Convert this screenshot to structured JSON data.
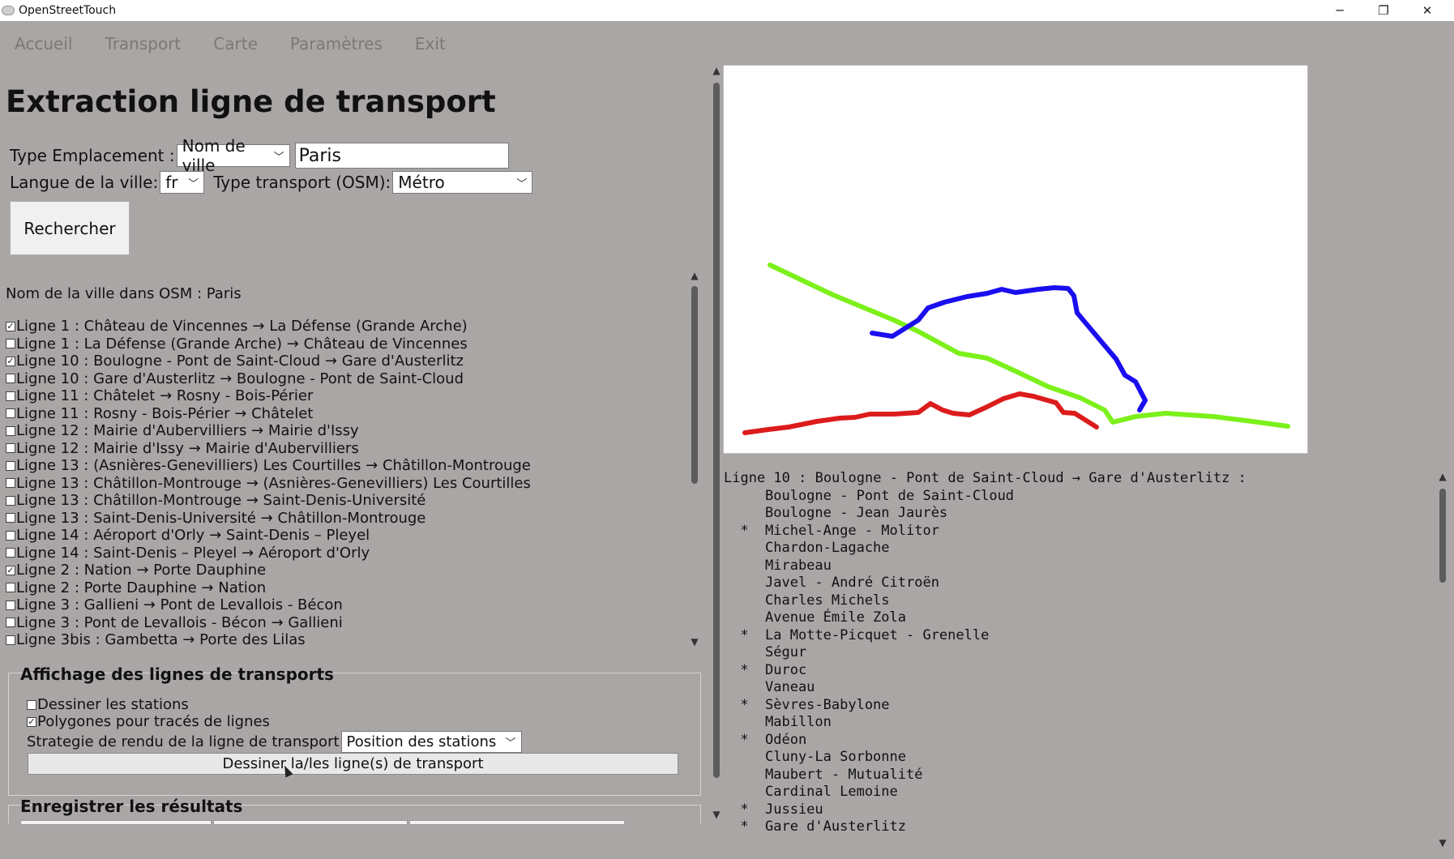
{
  "window": {
    "title": "OpenStreetTouch",
    "controls": [
      "─",
      "❐",
      "✕"
    ]
  },
  "menu": [
    "Accueil",
    "Transport",
    "Carte",
    "Paramètres",
    "Exit"
  ],
  "page": {
    "title": "Extraction ligne de transport"
  },
  "form": {
    "location_type_label": "Type Emplacement :",
    "location_type_value": "Nom de ville",
    "city_value": "Paris",
    "city_lang_label": "Langue de la ville:",
    "city_lang_value": "fr",
    "transport_type_label": "Type transport (OSM):",
    "transport_type_value": "Métro",
    "search_button": "Rechercher"
  },
  "osm_city": "Nom de la ville dans OSM : Paris",
  "lines": [
    {
      "label": "Ligne 1 : Château de Vincennes → La Défense (Grande Arche)",
      "checked": true
    },
    {
      "label": "Ligne 1 : La Défense (Grande Arche) → Château de Vincennes",
      "checked": false
    },
    {
      "label": "Ligne 10 : Boulogne - Pont de Saint-Cloud → Gare d'Austerlitz",
      "checked": true
    },
    {
      "label": "Ligne 10 : Gare d'Austerlitz → Boulogne - Pont de Saint-Cloud",
      "checked": false
    },
    {
      "label": "Ligne 11 : Châtelet → Rosny - Bois-Périer",
      "checked": false
    },
    {
      "label": "Ligne 11 : Rosny - Bois-Périer → Châtelet",
      "checked": false
    },
    {
      "label": "Ligne 12 : Mairie d'Aubervilliers → Mairie d'Issy",
      "checked": false
    },
    {
      "label": "Ligne 12 : Mairie d'Issy → Mairie d'Aubervilliers",
      "checked": false
    },
    {
      "label": "Ligne 13 : (Asnières-Genevilliers) Les Courtilles → Châtillon-Montrouge",
      "checked": false
    },
    {
      "label": "Ligne 13 : Châtillon-Montrouge → (Asnières-Genevilliers) Les Courtilles",
      "checked": false
    },
    {
      "label": "Ligne 13 : Châtillon-Montrouge → Saint-Denis-Université",
      "checked": false
    },
    {
      "label": "Ligne 13 : Saint-Denis-Université → Châtillon-Montrouge",
      "checked": false
    },
    {
      "label": "Ligne 14 : Aéroport d'Orly → Saint-Denis – Pleyel",
      "checked": false
    },
    {
      "label": "Ligne 14 : Saint-Denis – Pleyel → Aéroport d'Orly",
      "checked": false
    },
    {
      "label": "Ligne 2 : Nation → Porte Dauphine",
      "checked": true
    },
    {
      "label": "Ligne 2 : Porte Dauphine → Nation",
      "checked": false
    },
    {
      "label": "Ligne 3 : Gallieni → Pont de Levallois - Bécon",
      "checked": false
    },
    {
      "label": "Ligne 3 : Pont de Levallois - Bécon → Gallieni",
      "checked": false
    },
    {
      "label": "Ligne 3bis : Gambetta → Porte des Lilas",
      "checked": false
    }
  ],
  "display": {
    "title": "Affichage des lignes de transports",
    "draw_stations_label": "Dessiner les stations",
    "draw_stations_checked": false,
    "polygons_label": "Polygones pour tracés de lignes",
    "polygons_checked": true,
    "strategy_label": "Strategie de rendu de la ligne de transport",
    "strategy_value": "Position des stations",
    "draw_button": "Dessiner la/les ligne(s) de transport"
  },
  "save": {
    "title": "Enregistrer les résultats"
  },
  "map_colors": {
    "green": "#7cf01a",
    "blue": "#1a0ef0",
    "red": "#dc1c1c"
  },
  "stops": {
    "header": "Ligne 10 : Boulogne - Pont de Saint-Cloud → Gare d'Austerlitz :",
    "items": [
      {
        "mark": "",
        "name": "Boulogne - Pont de Saint-Cloud"
      },
      {
        "mark": "",
        "name": "Boulogne - Jean Jaurès"
      },
      {
        "mark": "*",
        "name": "Michel-Ange - Molitor"
      },
      {
        "mark": "",
        "name": "Chardon-Lagache"
      },
      {
        "mark": "",
        "name": "Mirabeau"
      },
      {
        "mark": "",
        "name": "Javel - André Citroën"
      },
      {
        "mark": "",
        "name": "Charles Michels"
      },
      {
        "mark": "",
        "name": "Avenue Émile Zola"
      },
      {
        "mark": "*",
        "name": "La Motte-Picquet - Grenelle"
      },
      {
        "mark": "",
        "name": "Ségur"
      },
      {
        "mark": "*",
        "name": "Duroc"
      },
      {
        "mark": "",
        "name": "Vaneau"
      },
      {
        "mark": "*",
        "name": "Sèvres-Babylone"
      },
      {
        "mark": "",
        "name": "Mabillon"
      },
      {
        "mark": "*",
        "name": "Odéon"
      },
      {
        "mark": "",
        "name": "Cluny-La Sorbonne"
      },
      {
        "mark": "",
        "name": "Maubert - Mutualité"
      },
      {
        "mark": "",
        "name": "Cardinal Lemoine"
      },
      {
        "mark": "*",
        "name": "Jussieu"
      },
      {
        "mark": "*",
        "name": "Gare d'Austerlitz"
      }
    ]
  }
}
